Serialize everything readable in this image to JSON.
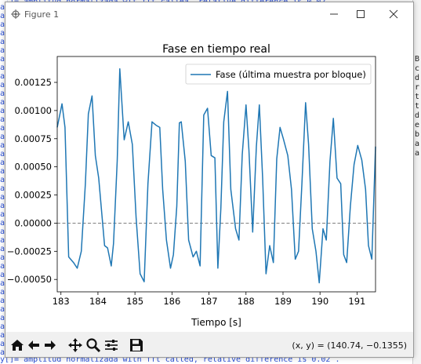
{
  "window": {
    "title": "Figure 1"
  },
  "toolbar": {
    "coords": "(x, y) = (140.74, −0.1355)"
  },
  "background": {
    "top_text": "y[]= amplitud normalizada wit fft caiiea, relative difference is 0.02 .",
    "bottom_text": "y[]= amplitud normalizada with fft called, relative difference is 0.02 .",
    "left_chars": [
      "a",
      "a",
      "a",
      "a",
      "a",
      "a",
      "a",
      "a",
      "a",
      "a",
      "a",
      "a",
      "a",
      "a",
      "a",
      "a",
      "a",
      "a",
      "a",
      "a",
      "a",
      "a",
      "a",
      "a",
      "a",
      "a",
      "a",
      "a",
      "a",
      "a",
      "a",
      "a",
      "a",
      "a",
      "a",
      "a",
      "a",
      "a",
      "a",
      "a",
      "a"
    ],
    "right_chars": [
      "B",
      "c",
      "d",
      "r",
      "t",
      "t",
      "d",
      "e",
      "b",
      "a",
      "a"
    ]
  },
  "chart_data": {
    "type": "line",
    "title": "Fase en tiempo real",
    "xlabel": "Tiempo [s]",
    "ylabel": "",
    "xlim": [
      182.9,
      191.5
    ],
    "ylim": [
      -0.00061,
      0.00148
    ],
    "xticks": [
      183,
      184,
      185,
      186,
      187,
      188,
      189,
      190,
      191
    ],
    "xtick_labels": [
      "183",
      "184",
      "185",
      "186",
      "187",
      "188",
      "189",
      "190",
      "191"
    ],
    "yticks": [
      0.00125,
      0.001,
      0.00075,
      0.0005,
      0.00025,
      0.0,
      -0.00025,
      -0.0005
    ],
    "ytick_labels": [
      "0.00125",
      "0.00100",
      "0.00075",
      "0.00050",
      "0.00025",
      "0.00000",
      "−0.00025",
      "−0.00050"
    ],
    "hline": 0.0,
    "legend": "upper right",
    "series": [
      {
        "name": "Fase (última muestra por bloque)",
        "color": "#1f77b4",
        "x": [
          182.9,
          183.03,
          183.11,
          183.21,
          183.34,
          183.44,
          183.55,
          183.66,
          183.74,
          183.84,
          183.93,
          184.02,
          184.18,
          184.26,
          184.36,
          184.42,
          184.52,
          184.59,
          184.71,
          184.82,
          184.93,
          185.03,
          185.14,
          185.25,
          185.35,
          185.46,
          185.57,
          185.67,
          185.75,
          185.85,
          185.96,
          186.04,
          186.13,
          186.2,
          186.25,
          186.36,
          186.45,
          186.57,
          186.66,
          186.76,
          186.86,
          186.96,
          187.06,
          187.16,
          187.24,
          187.32,
          187.4,
          187.5,
          187.59,
          187.72,
          187.81,
          187.9,
          188.0,
          188.08,
          188.18,
          188.28,
          188.36,
          188.45,
          188.54,
          188.64,
          188.74,
          188.83,
          188.92,
          189.01,
          189.13,
          189.23,
          189.33,
          189.42,
          189.51,
          189.61,
          189.69,
          189.79,
          189.89,
          189.98,
          190.08,
          190.17,
          190.27,
          190.36,
          190.46,
          190.56,
          190.64,
          190.72,
          190.82,
          190.92,
          191.02,
          191.13,
          191.23,
          191.31,
          191.4,
          191.5
        ],
        "y": [
          0.00085,
          0.00106,
          0.00085,
          -0.0003,
          -0.00035,
          -0.0004,
          -0.00025,
          0.00035,
          0.00097,
          0.00113,
          0.0006,
          0.0004,
          -0.0002,
          -0.00022,
          -0.00038,
          -0.00018,
          0.00055,
          0.00137,
          0.00074,
          0.0009,
          0.0007,
          5e-05,
          -0.00045,
          -0.00052,
          0.00035,
          0.0009,
          0.00087,
          0.00085,
          0.0003,
          -0.00015,
          -0.0004,
          -0.00028,
          0.00015,
          0.00089,
          0.0009,
          0.00055,
          -0.00015,
          -0.0003,
          -0.00025,
          -0.00038,
          0.00096,
          0.00102,
          0.0006,
          0.00058,
          -0.0004,
          0.00013,
          0.0009,
          0.00117,
          0.0003,
          -5e-05,
          -0.00015,
          0.00061,
          0.00105,
          0.00065,
          -8e-05,
          0.00068,
          0.00105,
          0.0004,
          -0.00045,
          -0.0002,
          -0.00035,
          0.00057,
          0.00085,
          0.00075,
          0.0006,
          0.0003,
          -0.00032,
          -0.00025,
          0.00035,
          0.00107,
          0.0007,
          -5e-05,
          -0.00025,
          -0.00053,
          -5e-05,
          -0.00015,
          0.00055,
          0.00093,
          0.0004,
          0.00035,
          -0.00028,
          -0.00035,
          0.00015,
          0.00052,
          0.00069,
          0.00056,
          0.0003,
          -0.0002,
          -0.00032,
          0.00068
        ]
      }
    ]
  }
}
